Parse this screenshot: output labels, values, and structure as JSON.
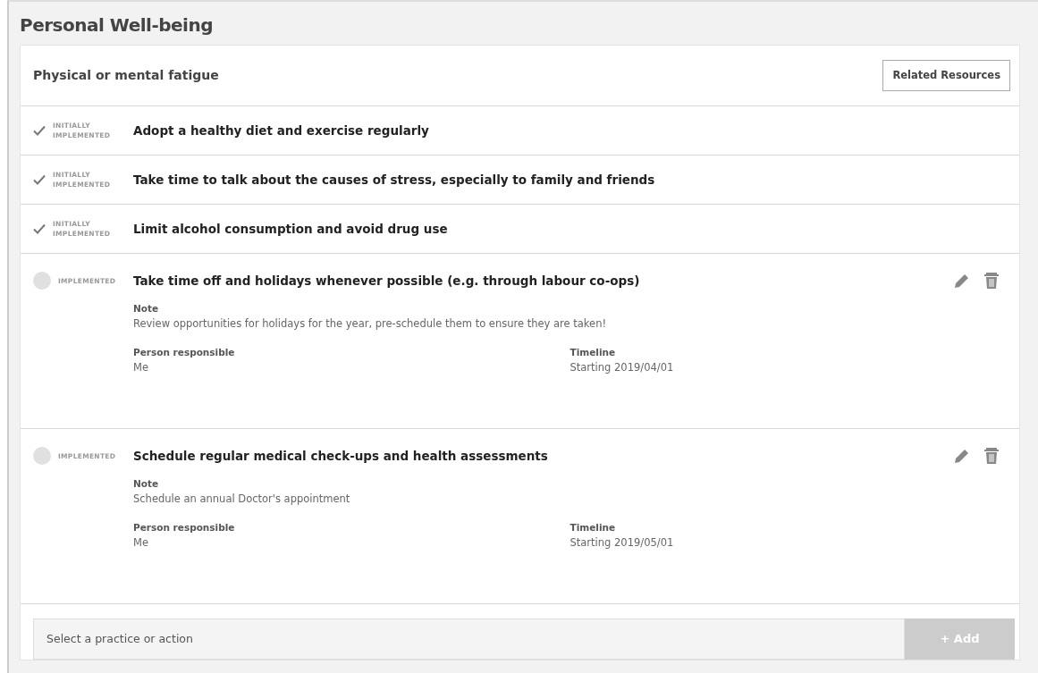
{
  "page_title": "Personal Well-being",
  "section": {
    "title": "Physical or mental fatigue",
    "resources_button": "Related Resources"
  },
  "practices": [
    {
      "kind": "brief",
      "implemented": true,
      "status": "INITIALLY IMPLEMENTED",
      "title": "Adopt a healthy diet and exercise regularly"
    },
    {
      "kind": "brief",
      "implemented": true,
      "status": "INITIALLY IMPLEMENTED",
      "title": "Take time to talk about the causes of stress, especially to family and friends"
    },
    {
      "kind": "brief",
      "implemented": true,
      "status": "INITIALLY IMPLEMENTED",
      "title": "Limit alcohol consumption and avoid drug use"
    },
    {
      "kind": "detailed",
      "implemented": false,
      "status": "IMPLEMENTED",
      "title": "Take time off and holidays whenever possible (e.g. through labour co-ops)",
      "note_label": "Note",
      "note": "Review opportunities for holidays for the year, pre-schedule them to ensure they are taken!",
      "person_label": "Person responsible",
      "person": "Me",
      "timeline_label": "Timeline",
      "timeline": "Starting 2019/04/01"
    },
    {
      "kind": "detailed",
      "implemented": false,
      "status": "IMPLEMENTED",
      "title": "Schedule regular medical check-ups and health assessments",
      "note_label": "Note",
      "note": "Schedule an annual Doctor's appointment",
      "person_label": "Person responsible",
      "person": "Me",
      "timeline_label": "Timeline",
      "timeline": "Starting 2019/05/01"
    }
  ],
  "add_form": {
    "placeholder": "Select a practice or action",
    "add_button": "+ Add",
    "disabled": true
  }
}
